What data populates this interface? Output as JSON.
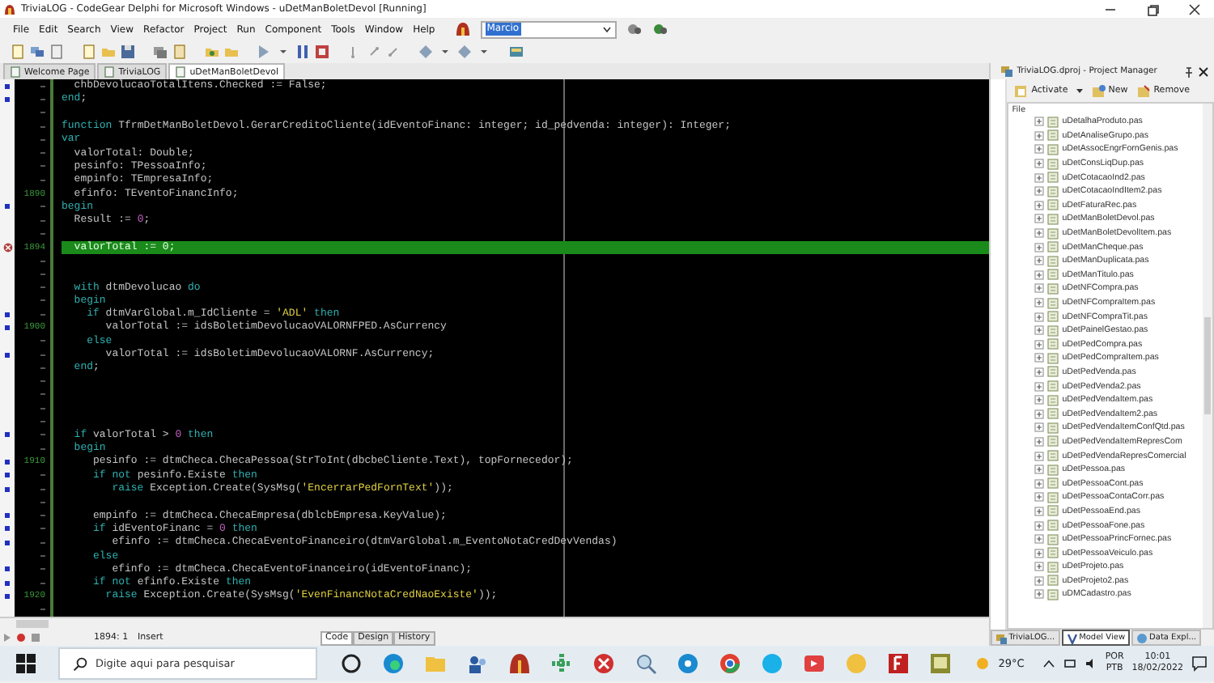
{
  "window": {
    "title": "TriviaLOG - CodeGear Delphi for Microsoft Windows - uDetManBoletDevol [Running]"
  },
  "menu": [
    "File",
    "Edit",
    "Search",
    "View",
    "Refactor",
    "Project",
    "Run",
    "Component",
    "Tools",
    "Window",
    "Help"
  ],
  "layout_combo": {
    "value": "Marcio"
  },
  "editor_tabs": [
    {
      "label": "Welcome Page",
      "selected": false
    },
    {
      "label": "TriviaLOG",
      "selected": false
    },
    {
      "label": "uDetManBoletDevol",
      "selected": true
    }
  ],
  "code_lines": [
    {
      "breakpoint": true,
      "error": false,
      "current": false,
      "code": [
        {
          "kind": "plain",
          "text": "  chbDevolucaoTotalItens.Checked := False;"
        }
      ]
    },
    {
      "breakpoint": true,
      "error": false,
      "current": false,
      "code": [
        {
          "kind": "keyword",
          "text": "end"
        },
        {
          "kind": "plain",
          "text": ";"
        }
      ]
    },
    {
      "breakpoint": false,
      "error": false,
      "current": false
    },
    {
      "breakpoint": false,
      "error": false,
      "current": false,
      "code": [
        {
          "kind": "keyword",
          "text": "function"
        },
        {
          "kind": "plain",
          "text": " TfrmDetManBoletDevol.GerarCreditoCliente(idEventoFinanc: integer; id_pedvenda: integer): Integer;"
        }
      ]
    },
    {
      "breakpoint": false,
      "error": false,
      "current": false,
      "code": [
        {
          "kind": "keyword",
          "text": "var"
        }
      ]
    },
    {
      "breakpoint": false,
      "error": false,
      "current": false,
      "code": [
        {
          "kind": "plain",
          "text": "  valorTotal: Double;"
        }
      ]
    },
    {
      "breakpoint": false,
      "error": false,
      "current": false,
      "code": [
        {
          "kind": "plain",
          "text": "  pesinfo: TPessoaInfo;"
        }
      ]
    },
    {
      "breakpoint": false,
      "error": false,
      "current": false,
      "code": [
        {
          "kind": "plain",
          "text": "  empinfo: TEmpresaInfo;"
        }
      ]
    },
    {
      "number": "1890",
      "breakpoint": false,
      "error": false,
      "current": false,
      "code": [
        {
          "kind": "plain",
          "text": "  efinfo: TEventoFinancInfo;"
        }
      ]
    },
    {
      "breakpoint": true,
      "error": false,
      "current": false,
      "code": [
        {
          "kind": "keyword",
          "text": "begin"
        }
      ]
    },
    {
      "breakpoint": false,
      "error": false,
      "current": false,
      "code": [
        {
          "kind": "plain",
          "text": "  Result := "
        },
        {
          "kind": "number",
          "text": "0"
        },
        {
          "kind": "plain",
          "text": ";"
        }
      ]
    },
    {
      "breakpoint": false,
      "error": false,
      "current": false
    },
    {
      "number": "1894",
      "breakpoint": false,
      "error": true,
      "current": true,
      "code": [
        {
          "kind": "plain",
          "text": "  valorTotal := "
        },
        {
          "kind": "number",
          "text": "0"
        },
        {
          "kind": "plain",
          "text": ";"
        }
      ]
    },
    {
      "breakpoint": false,
      "error": false,
      "current": false
    },
    {
      "breakpoint": false,
      "error": false,
      "current": false
    },
    {
      "breakpoint": false,
      "error": false,
      "current": false,
      "code": [
        {
          "kind": "keyword",
          "text": "  with"
        },
        {
          "kind": "plain",
          "text": " dtmDevolucao "
        },
        {
          "kind": "keyword",
          "text": "do"
        }
      ]
    },
    {
      "breakpoint": false,
      "error": false,
      "current": false,
      "code": [
        {
          "kind": "keyword",
          "text": "  begin"
        }
      ]
    },
    {
      "breakpoint": true,
      "error": false,
      "current": false,
      "code": [
        {
          "kind": "keyword",
          "text": "    if"
        },
        {
          "kind": "plain",
          "text": " dtmVarGlobal.m_IdCliente = "
        },
        {
          "kind": "string",
          "text": "'ADL'"
        },
        {
          "kind": "keyword",
          "text": " then"
        }
      ]
    },
    {
      "number": "1900",
      "breakpoint": true,
      "error": false,
      "current": false,
      "code": [
        {
          "kind": "plain",
          "text": "       valorTotal := idsBoletimDevolucaoVALORNFPED.AsCurrency"
        }
      ]
    },
    {
      "breakpoint": false,
      "error": false,
      "current": false,
      "code": [
        {
          "kind": "keyword",
          "text": "    else"
        }
      ]
    },
    {
      "breakpoint": true,
      "error": false,
      "current": false,
      "code": [
        {
          "kind": "plain",
          "text": "       valorTotal := idsBoletimDevolucaoVALORNF.AsCurrency;"
        }
      ]
    },
    {
      "breakpoint": false,
      "error": false,
      "current": false,
      "code": [
        {
          "kind": "keyword",
          "text": "  end"
        },
        {
          "kind": "plain",
          "text": ";"
        }
      ]
    },
    {
      "breakpoint": false,
      "error": false,
      "current": false
    },
    {
      "breakpoint": false,
      "error": false,
      "current": false
    },
    {
      "breakpoint": false,
      "error": false,
      "current": false
    },
    {
      "breakpoint": false,
      "error": false,
      "current": false
    },
    {
      "breakpoint": true,
      "error": false,
      "current": false,
      "code": [
        {
          "kind": "keyword",
          "text": "  if"
        },
        {
          "kind": "plain",
          "text": " valorTotal > "
        },
        {
          "kind": "number",
          "text": "0"
        },
        {
          "kind": "keyword",
          "text": " then"
        }
      ]
    },
    {
      "breakpoint": false,
      "error": false,
      "current": false,
      "code": [
        {
          "kind": "keyword",
          "text": "  begin"
        }
      ]
    },
    {
      "number": "1910",
      "breakpoint": true,
      "error": false,
      "current": false,
      "code": [
        {
          "kind": "plain",
          "text": "     pesinfo := dtmCheca.ChecaPessoa(StrToInt(dbcbeCliente.Text), topFornecedor);"
        }
      ]
    },
    {
      "breakpoint": true,
      "error": false,
      "current": false,
      "code": [
        {
          "kind": "keyword",
          "text": "     if not"
        },
        {
          "kind": "plain",
          "text": " pesinfo.Existe "
        },
        {
          "kind": "keyword",
          "text": "then"
        }
      ]
    },
    {
      "breakpoint": true,
      "error": false,
      "current": false,
      "code": [
        {
          "kind": "keyword",
          "text": "        raise"
        },
        {
          "kind": "plain",
          "text": " Exception.Create(SysMsg("
        },
        {
          "kind": "string",
          "text": "'EncerrarPedFornText'"
        },
        {
          "kind": "plain",
          "text": "));"
        }
      ]
    },
    {
      "breakpoint": false,
      "error": false,
      "current": false
    },
    {
      "breakpoint": true,
      "error": false,
      "current": false,
      "code": [
        {
          "kind": "plain",
          "text": "     empinfo := dtmCheca.ChecaEmpresa(dblcbEmpresa.KeyValue);"
        }
      ]
    },
    {
      "breakpoint": true,
      "error": false,
      "current": false,
      "code": [
        {
          "kind": "keyword",
          "text": "     if"
        },
        {
          "kind": "plain",
          "text": " idEventoFinanc = "
        },
        {
          "kind": "number",
          "text": "0"
        },
        {
          "kind": "keyword",
          "text": " then"
        }
      ]
    },
    {
      "breakpoint": true,
      "error": false,
      "current": false,
      "code": [
        {
          "kind": "plain",
          "text": "        efinfo := dtmCheca.ChecaEventoFinanceiro(dtmVarGlobal.m_EventoNotaCredDevVendas)"
        }
      ]
    },
    {
      "breakpoint": false,
      "error": false,
      "current": false,
      "code": [
        {
          "kind": "keyword",
          "text": "     else"
        }
      ]
    },
    {
      "breakpoint": true,
      "error": false,
      "current": false,
      "code": [
        {
          "kind": "plain",
          "text": "        efinfo := dtmCheca.ChecaEventoFinanceiro(idEventoFinanc);"
        }
      ]
    },
    {
      "breakpoint": true,
      "error": false,
      "current": false,
      "code": [
        {
          "kind": "keyword",
          "text": "     if not"
        },
        {
          "kind": "plain",
          "text": " efinfo.Existe "
        },
        {
          "kind": "keyword",
          "text": "then"
        }
      ]
    },
    {
      "number": "1920",
      "breakpoint": true,
      "error": false,
      "current": false,
      "code": [
        {
          "kind": "keyword",
          "text": "       raise"
        },
        {
          "kind": "plain",
          "text": " Exception.Create(SysMsg("
        },
        {
          "kind": "string",
          "text": "'EvenFinancNotaCredNaoExiste'"
        },
        {
          "kind": "plain",
          "text": "));"
        }
      ]
    },
    {
      "breakpoint": false,
      "error": false,
      "current": false
    }
  ],
  "status_bar": {
    "position": "1894: 1",
    "mode": "Insert",
    "view_tabs": [
      {
        "label": "Code",
        "selected": true
      },
      {
        "label": "Design",
        "selected": false
      },
      {
        "label": "History",
        "selected": false
      }
    ]
  },
  "project_manager": {
    "title": "TriviaLOG.dproj - Project Manager",
    "buttons": [
      "Activate",
      "New",
      "Remove"
    ],
    "column": "File",
    "files": [
      "uDetalhaProduto.pas",
      "uDetAnaliseGrupo.pas",
      "uDetAssocEngrFornGenis.pas",
      "uDetConsLiqDup.pas",
      "uDetCotacaoInd2.pas",
      "uDetCotacaoIndItem2.pas",
      "uDetFaturaRec.pas",
      "uDetManBoletDevol.pas",
      "uDetManBoletDevolItem.pas",
      "uDetManCheque.pas",
      "uDetManDuplicata.pas",
      "uDetManTitulo.pas",
      "uDetNFCompra.pas",
      "uDetNFCompraItem.pas",
      "uDetNFCompraTit.pas",
      "uDetPainelGestao.pas",
      "uDetPedCompra.pas",
      "uDetPedCompraItem.pas",
      "uDetPedVenda.pas",
      "uDetPedVenda2.pas",
      "uDetPedVendaItem.pas",
      "uDetPedVendaItem2.pas",
      "uDetPedVendaItemConfQtd.pas",
      "uDetPedVendaItemRepresCom",
      "uDetPedVendaRepresComercial",
      "uDetPessoa.pas",
      "uDetPessoaCont.pas",
      "uDetPessoaContaCorr.pas",
      "uDetPessoaEnd.pas",
      "uDetPessoaFone.pas",
      "uDetPessoaPrincFornec.pas",
      "uDetPessoaVeiculo.pas",
      "uDetProjeto.pas",
      "uDetProjeto2.pas",
      "uDMCadastro.pas"
    ]
  },
  "panel_tabs": [
    {
      "label": "TriviaLOG...",
      "selected": false
    },
    {
      "label": "Model View",
      "selected": true
    },
    {
      "label": "Data Expl...",
      "selected": false
    }
  ],
  "taskbar": {
    "search_placeholder": "Digite aqui para pesquisar",
    "temperature": "29°C",
    "language": [
      "POR",
      "PTB"
    ],
    "time": "10:01",
    "date": "18/02/2022"
  }
}
